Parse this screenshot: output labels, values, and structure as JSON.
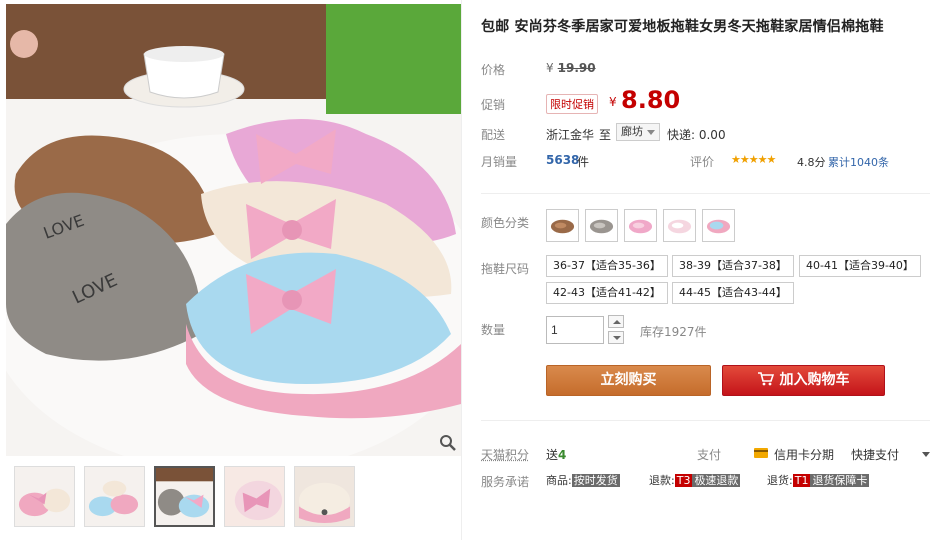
{
  "product": {
    "title": "包邮 安尚芬冬季居家可爱地板拖鞋女男冬天拖鞋家居情侣棉拖鞋"
  },
  "price": {
    "label": "价格",
    "currency": "¥",
    "original": "19.90"
  },
  "promo": {
    "label": "促销",
    "badge": "限时促销",
    "currency": "¥",
    "price": "8.80"
  },
  "shipping": {
    "label": "配送",
    "from": "浙江金华",
    "to_word": "至",
    "city": "廊坊",
    "express": "快递: 0.00"
  },
  "sales": {
    "label": "月销量",
    "count": "5638",
    "unit": "件",
    "rating_label": "评价",
    "stars": "★★★★★",
    "score": "4.8分",
    "reviews": "累计1040条"
  },
  "color": {
    "label": "颜色分类",
    "options": [
      "brown",
      "gray",
      "pink",
      "pink-white",
      "blue-pink"
    ]
  },
  "size": {
    "label": "拖鞋尺码",
    "options": [
      "36-37【适合35-36】",
      "38-39【适合37-38】",
      "40-41【适合39-40】",
      "42-43【适合41-42】",
      "44-45【适合43-44】"
    ]
  },
  "quantity": {
    "label": "数量",
    "value": "1",
    "stock": "库存1927件"
  },
  "actions": {
    "buy_now": "立刻购买",
    "add_to_cart": "加入购物车"
  },
  "points": {
    "label": "天猫积分",
    "prefix": "送",
    "value": "4"
  },
  "payment": {
    "label": "支付",
    "card": "信用卡分期",
    "quick": "快捷支付"
  },
  "promise": {
    "label": "服务承诺",
    "goods_prefix": "商品:",
    "goods_tag": "按时发货",
    "refund_prefix": "退款:",
    "refund_code": "T3",
    "refund_tag": "极速退款",
    "return_prefix": "退货:",
    "return_code": "T1",
    "return_tag": "退货保障卡"
  },
  "colors_theme": {
    "accent_red": "#c40000",
    "buy_orange": "#d07a3a",
    "link_blue": "#3366aa"
  }
}
